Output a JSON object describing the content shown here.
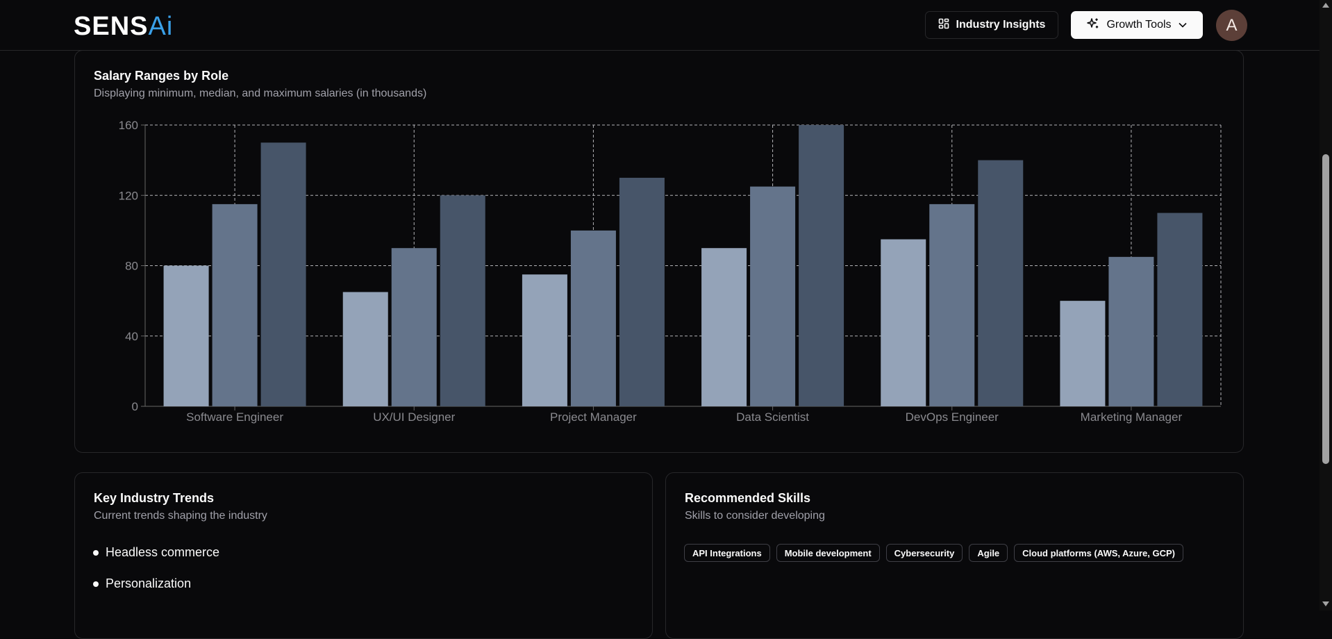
{
  "brand": {
    "logo_main": "SENS",
    "logo_ai": "Ai"
  },
  "header": {
    "insights_label": "Industry Insights",
    "growth_label": "Growth Tools",
    "avatar_initial": "A"
  },
  "salary_card": {
    "title": "Salary Ranges by Role",
    "subtitle": "Displaying minimum, median, and maximum salaries (in thousands)"
  },
  "chart_data": {
    "type": "bar",
    "categories": [
      "Software Engineer",
      "UX/UI Designer",
      "Project Manager",
      "Data Scientist",
      "DevOps Engineer",
      "Marketing Manager"
    ],
    "series": [
      {
        "values": [
          80,
          65,
          75,
          90,
          95,
          60
        ],
        "color": "#94a3b8"
      },
      {
        "values": [
          115,
          90,
          100,
          125,
          115,
          85
        ],
        "color": "#64748b"
      },
      {
        "values": [
          150,
          120,
          130,
          160,
          140,
          110
        ],
        "color": "#475569"
      }
    ],
    "yticks": [
      0,
      40,
      80,
      120,
      160
    ],
    "ylim": [
      0,
      160
    ],
    "grid": true,
    "xlabel": "",
    "ylabel": ""
  },
  "trends_card": {
    "title": "Key Industry Trends",
    "subtitle": "Current trends shaping the industry",
    "items": [
      "Headless commerce",
      "Personalization"
    ]
  },
  "skills_card": {
    "title": "Recommended Skills",
    "subtitle": "Skills to consider developing",
    "skills": [
      "API Integrations",
      "Mobile development",
      "Cybersecurity",
      "Agile",
      "Cloud platforms (AWS, Azure, GCP)"
    ]
  }
}
